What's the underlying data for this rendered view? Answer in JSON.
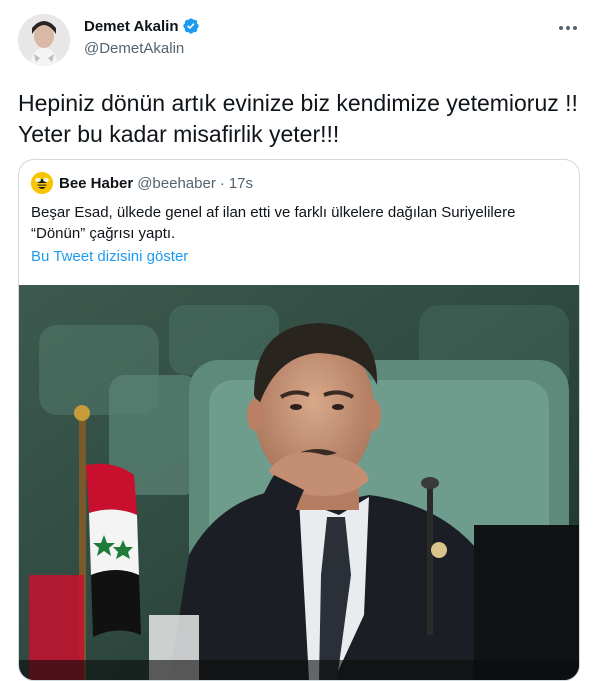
{
  "tweet": {
    "author": {
      "display_name": "Demet Akalin",
      "handle": "@DemetAkalin",
      "verified": true
    },
    "text": "Hepiniz dönün artık evinize biz kendimize yetemioruz !! Yeter bu kadar misafirlik yeter!!!",
    "more_icon": "more-horizontal-icon"
  },
  "quote": {
    "author": {
      "display_name": "Bee Haber",
      "handle": "@beehaber",
      "separator": "·",
      "time": "17s"
    },
    "text": "Beşar Esad, ülkede genel af ilan etti ve farklı ülkelere dağılan Suriyelilere “Dönün” çağrısı yaptı.",
    "show_thread": "Bu Tweet dizisini göster",
    "media_description": "photo"
  },
  "colors": {
    "text_primary": "#0f1419",
    "text_secondary": "#536471",
    "link": "#1d9bf0",
    "border": "#cfd9de",
    "verified": "#1d9bf0"
  }
}
